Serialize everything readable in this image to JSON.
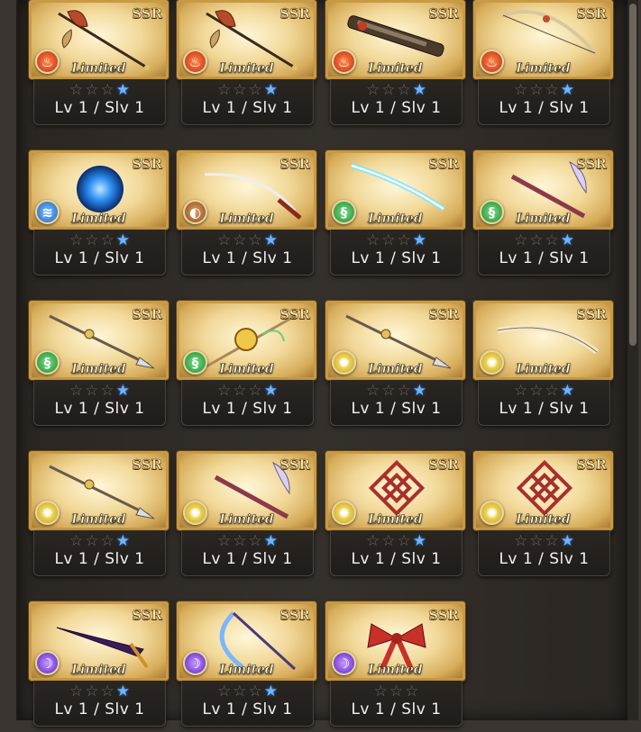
{
  "cards": [
    {
      "rarity": "SSR",
      "tag": "Limited",
      "element": "fire",
      "element_icon": "flame-icon",
      "weapon_icon": "axe-icon",
      "stars_gray": 3,
      "stars_blue": 1,
      "level": "Lv 1 / Slv 1"
    },
    {
      "rarity": "SSR",
      "tag": "Limited",
      "element": "fire",
      "element_icon": "flame-icon",
      "weapon_icon": "axe-icon",
      "stars_gray": 3,
      "stars_blue": 1,
      "level": "Lv 1 / Slv 1"
    },
    {
      "rarity": "SSR",
      "tag": "Limited",
      "element": "fire",
      "element_icon": "flame-icon",
      "weapon_icon": "gun-icon",
      "stars_gray": 3,
      "stars_blue": 1,
      "level": "Lv 1 / Slv 1"
    },
    {
      "rarity": "SSR",
      "tag": "Limited",
      "element": "fire",
      "element_icon": "flame-icon",
      "weapon_icon": "bow-icon",
      "stars_gray": 3,
      "stars_blue": 1,
      "level": "Lv 1 / Slv 1"
    },
    {
      "rarity": "SSR",
      "tag": "Limited",
      "element": "water",
      "element_icon": "water-drop-icon",
      "weapon_icon": "orb-icon",
      "stars_gray": 3,
      "stars_blue": 1,
      "level": "Lv 1 / Slv 1"
    },
    {
      "rarity": "SSR",
      "tag": "Limited",
      "element": "earth",
      "element_icon": "earth-icon",
      "weapon_icon": "katana-icon",
      "stars_gray": 3,
      "stars_blue": 1,
      "level": "Lv 1 / Slv 1"
    },
    {
      "rarity": "SSR",
      "tag": "Limited",
      "element": "wind",
      "element_icon": "wind-icon",
      "weapon_icon": "ice-blade-icon",
      "stars_gray": 3,
      "stars_blue": 1,
      "level": "Lv 1 / Slv 1"
    },
    {
      "rarity": "SSR",
      "tag": "Limited",
      "element": "wind",
      "element_icon": "wind-icon",
      "weapon_icon": "staff-icon",
      "stars_gray": 3,
      "stars_blue": 1,
      "level": "Lv 1 / Slv 1"
    },
    {
      "rarity": "SSR",
      "tag": "Limited",
      "element": "wind",
      "element_icon": "wind-icon",
      "weapon_icon": "spear-icon",
      "stars_gray": 3,
      "stars_blue": 1,
      "level": "Lv 1 / Slv 1"
    },
    {
      "rarity": "SSR",
      "tag": "Limited",
      "element": "wind",
      "element_icon": "wind-icon",
      "weapon_icon": "scepter-icon",
      "stars_gray": 3,
      "stars_blue": 1,
      "level": "Lv 1 / Slv 1"
    },
    {
      "rarity": "SSR",
      "tag": "Limited",
      "element": "light",
      "element_icon": "sun-icon",
      "weapon_icon": "spear-icon",
      "stars_gray": 3,
      "stars_blue": 1,
      "level": "Lv 1 / Slv 1"
    },
    {
      "rarity": "SSR",
      "tag": "Limited",
      "element": "light",
      "element_icon": "sun-icon",
      "weapon_icon": "sword-icon",
      "stars_gray": 3,
      "stars_blue": 1,
      "level": "Lv 1 / Slv 1"
    },
    {
      "rarity": "SSR",
      "tag": "Limited",
      "element": "light",
      "element_icon": "sun-icon",
      "weapon_icon": "spear-icon",
      "stars_gray": 3,
      "stars_blue": 1,
      "level": "Lv 1 / Slv 1"
    },
    {
      "rarity": "SSR",
      "tag": "Limited",
      "element": "light",
      "element_icon": "sun-icon",
      "weapon_icon": "staff-icon",
      "stars_gray": 3,
      "stars_blue": 1,
      "level": "Lv 1 / Slv 1"
    },
    {
      "rarity": "SSR",
      "tag": "Limited",
      "element": "light",
      "element_icon": "sun-icon",
      "weapon_icon": "knot-icon",
      "stars_gray": 3,
      "stars_blue": 1,
      "level": "Lv 1 / Slv 1"
    },
    {
      "rarity": "SSR",
      "tag": "Limited",
      "element": "light",
      "element_icon": "sun-icon",
      "weapon_icon": "knot-icon",
      "stars_gray": 3,
      "stars_blue": 1,
      "level": "Lv 1 / Slv 1"
    },
    {
      "rarity": "SSR",
      "tag": "Limited",
      "element": "dark",
      "element_icon": "crescent-icon",
      "weapon_icon": "dagger-icon",
      "stars_gray": 3,
      "stars_blue": 1,
      "level": "Lv 1 / Slv 1"
    },
    {
      "rarity": "SSR",
      "tag": "Limited",
      "element": "dark",
      "element_icon": "crescent-icon",
      "weapon_icon": "scythe-icon",
      "stars_gray": 3,
      "stars_blue": 1,
      "level": "Lv 1 / Slv 1"
    },
    {
      "rarity": "SSR",
      "tag": "Limited",
      "element": "dark",
      "element_icon": "crescent-icon",
      "weapon_icon": "ribbon-icon",
      "stars_gray": 3,
      "stars_blue": 0,
      "level": "Lv 1 / Slv 1"
    }
  ],
  "colors": {
    "frame_gold": "#c89a44",
    "panel_dark": "#2b2622",
    "star_blue": "#6fb4ff",
    "star_gray": "#6d6a66"
  }
}
